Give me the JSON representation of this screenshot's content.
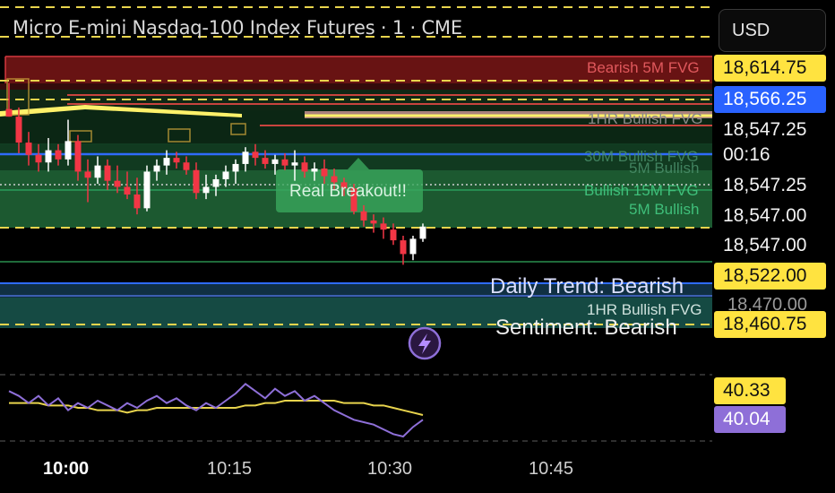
{
  "header": {
    "title": "Micro E-mini Nasdaq-100 Index Futures · 1 · CME",
    "currency_label": "USD"
  },
  "colors": {
    "up_candle": "#ffffff",
    "down_candle": "#f23645",
    "bearish_zone": "#8b1a1a",
    "bullish_zone": "#1f6b3a",
    "trend_line": "#fff16a",
    "rsi_line": "#8e6fd8",
    "rsi_ma": "#e8d44d",
    "last_price_bg": "#2962ff"
  },
  "price_labels": [
    {
      "text": "18,614.75",
      "style": "yellow"
    },
    {
      "text": "18,566.25",
      "style": "blue"
    },
    {
      "text": "18,547.25",
      "style": "plain"
    },
    {
      "text": "00:16",
      "style": "plain"
    },
    {
      "text": "18,547.25",
      "style": "plain"
    },
    {
      "text": "18,547.00",
      "style": "plain"
    },
    {
      "text": "18,547.00",
      "style": "plain"
    },
    {
      "text": "18,522.00",
      "style": "yellow"
    },
    {
      "text": "18,460.75",
      "style": "yellow"
    }
  ],
  "annotations": {
    "bearish_5m_fvg": "Bearish 5M FVG",
    "bullish_1hr_fvg_top": "1HR Bullish FVG",
    "bullish_30m_fvg": "30M Bullish FVG",
    "bullish_5m_a": "5M Bullish",
    "bullish_15m_fvg": "Bullish 15M FVG",
    "bullish_5m_b": "5M Bullish",
    "real_breakout": "Real Breakout!!",
    "daily_trend": "Daily Trend: Bearish",
    "bullish_1hr_fvg_bottom": "1HR Bullish FVG",
    "price_18470": "18,470.00",
    "sentiment": "Sentiment: Bearish"
  },
  "rsi_labels": {
    "ma_value": "40.33",
    "rsi_value": "40.04"
  },
  "x_axis": {
    "ticks": [
      "10:00",
      "10:15",
      "10:30",
      "10:45"
    ]
  },
  "chart_data": {
    "type": "candlestick",
    "title": "Micro E-mini Nasdaq-100 Index Futures · 1 · CME",
    "interval": "1 minute",
    "ylim": [
      18450,
      18632
    ],
    "x_ticks": [
      "10:00",
      "10:15",
      "10:30",
      "10:45"
    ],
    "candles": [
      {
        "o": 18597,
        "h": 18614,
        "l": 18592,
        "c": 18592
      },
      {
        "o": 18592,
        "h": 18598,
        "l": 18568,
        "c": 18575
      },
      {
        "o": 18575,
        "h": 18582,
        "l": 18560,
        "c": 18567
      },
      {
        "o": 18567,
        "h": 18574,
        "l": 18556,
        "c": 18562
      },
      {
        "o": 18562,
        "h": 18578,
        "l": 18556,
        "c": 18570
      },
      {
        "o": 18570,
        "h": 18574,
        "l": 18560,
        "c": 18564
      },
      {
        "o": 18564,
        "h": 18590,
        "l": 18560,
        "c": 18576
      },
      {
        "o": 18576,
        "h": 18580,
        "l": 18550,
        "c": 18556
      },
      {
        "o": 18556,
        "h": 18564,
        "l": 18536,
        "c": 18552
      },
      {
        "o": 18552,
        "h": 18566,
        "l": 18548,
        "c": 18560
      },
      {
        "o": 18560,
        "h": 18564,
        "l": 18544,
        "c": 18550
      },
      {
        "o": 18550,
        "h": 18560,
        "l": 18542,
        "c": 18546
      },
      {
        "o": 18546,
        "h": 18556,
        "l": 18538,
        "c": 18541
      },
      {
        "o": 18541,
        "h": 18552,
        "l": 18528,
        "c": 18532
      },
      {
        "o": 18532,
        "h": 18560,
        "l": 18530,
        "c": 18556
      },
      {
        "o": 18556,
        "h": 18564,
        "l": 18550,
        "c": 18560
      },
      {
        "o": 18560,
        "h": 18570,
        "l": 18554,
        "c": 18565
      },
      {
        "o": 18565,
        "h": 18569,
        "l": 18558,
        "c": 18562
      },
      {
        "o": 18562,
        "h": 18566,
        "l": 18554,
        "c": 18557
      },
      {
        "o": 18557,
        "h": 18562,
        "l": 18538,
        "c": 18542
      },
      {
        "o": 18542,
        "h": 18554,
        "l": 18538,
        "c": 18546
      },
      {
        "o": 18546,
        "h": 18554,
        "l": 18540,
        "c": 18551
      },
      {
        "o": 18551,
        "h": 18560,
        "l": 18546,
        "c": 18556
      },
      {
        "o": 18556,
        "h": 18564,
        "l": 18548,
        "c": 18561
      },
      {
        "o": 18561,
        "h": 18572,
        "l": 18556,
        "c": 18569
      },
      {
        "o": 18569,
        "h": 18574,
        "l": 18560,
        "c": 18565
      },
      {
        "o": 18565,
        "h": 18570,
        "l": 18558,
        "c": 18561
      },
      {
        "o": 18561,
        "h": 18567,
        "l": 18554,
        "c": 18564
      },
      {
        "o": 18564,
        "h": 18568,
        "l": 18557,
        "c": 18560
      },
      {
        "o": 18560,
        "h": 18570,
        "l": 18550,
        "c": 18562
      },
      {
        "o": 18562,
        "h": 18566,
        "l": 18552,
        "c": 18556
      },
      {
        "o": 18556,
        "h": 18562,
        "l": 18550,
        "c": 18558
      },
      {
        "o": 18558,
        "h": 18564,
        "l": 18548,
        "c": 18553
      },
      {
        "o": 18553,
        "h": 18558,
        "l": 18544,
        "c": 18549
      },
      {
        "o": 18549,
        "h": 18552,
        "l": 18540,
        "c": 18545
      },
      {
        "o": 18545,
        "h": 18548,
        "l": 18528,
        "c": 18530
      },
      {
        "o": 18530,
        "h": 18534,
        "l": 18520,
        "c": 18524
      },
      {
        "o": 18524,
        "h": 18528,
        "l": 18516,
        "c": 18522
      },
      {
        "o": 18522,
        "h": 18526,
        "l": 18512,
        "c": 18518
      },
      {
        "o": 18518,
        "h": 18522,
        "l": 18508,
        "c": 18511
      },
      {
        "o": 18511,
        "h": 18514,
        "l": 18495,
        "c": 18502
      },
      {
        "o": 18502,
        "h": 18514,
        "l": 18498,
        "c": 18512
      },
      {
        "o": 18512,
        "h": 18522,
        "l": 18510,
        "c": 18520
      }
    ],
    "horizontal_levels": [
      {
        "price": 18614.75,
        "label": "Bearish 5M FVG"
      },
      {
        "price": 18566.25
      },
      {
        "price": 18547.25
      },
      {
        "price": 18522.0,
        "label": "Daily Trend: Bearish"
      },
      {
        "price": 18460.75,
        "label": "Sentiment: Bearish"
      }
    ],
    "rsi": {
      "rsi_value": 40.04,
      "ma_value": 40.33,
      "values": [
        52,
        50,
        47,
        50,
        46,
        49,
        44,
        47,
        45,
        48,
        46,
        44,
        47,
        45,
        48,
        50,
        47,
        49,
        46,
        44,
        47,
        45,
        48,
        51,
        55,
        52,
        49,
        53,
        50,
        52,
        48,
        50,
        47,
        44,
        42,
        40,
        39,
        38,
        36,
        34,
        33,
        37,
        40
      ],
      "ma": [
        47,
        47,
        47,
        47,
        46,
        46,
        46,
        45,
        45,
        44,
        44,
        44,
        43,
        44,
        44,
        45,
        45,
        45,
        45,
        45,
        45,
        45,
        45,
        45,
        46,
        46,
        47,
        47,
        48,
        48,
        48,
        48,
        48,
        48,
        47,
        47,
        47,
        46,
        46,
        45,
        44,
        43,
        42
      ]
    }
  }
}
